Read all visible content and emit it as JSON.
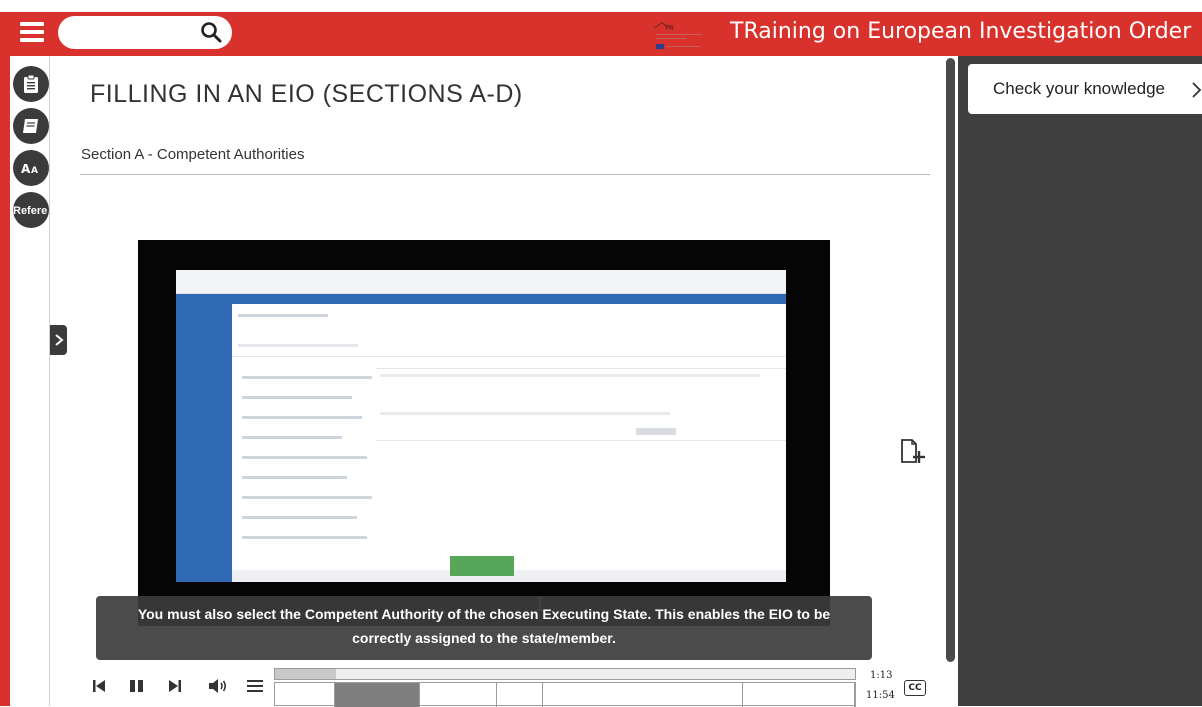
{
  "header": {
    "title": "TRaining on European Investigation Order",
    "search_placeholder": ""
  },
  "sidebar": {
    "items": [
      {
        "icon": "clipboard-icon"
      },
      {
        "icon": "notebook-icon"
      },
      {
        "icon": "font-size-icon"
      },
      {
        "label": "Refere"
      }
    ]
  },
  "content": {
    "page_title": "FILLING IN AN EIO (SECTIONS A-D)",
    "section_heading": "Section A - Competent Authorities"
  },
  "video": {
    "caption_line1": "You must also select the Competent Authority of the chosen Executing State. This enables the EIO to be",
    "caption_line2": "correctly assigned to the state/member.",
    "current_time": "1:13",
    "total_time": "11:54",
    "progress": 0.105,
    "cc_label": "CC",
    "chapters_count": 7,
    "active_chapter": 2
  },
  "right_panel": {
    "check_knowledge_label": "Check your knowledge"
  },
  "colors": {
    "brand_red": "#d9312b",
    "dark_panel": "#3f3f3f"
  }
}
